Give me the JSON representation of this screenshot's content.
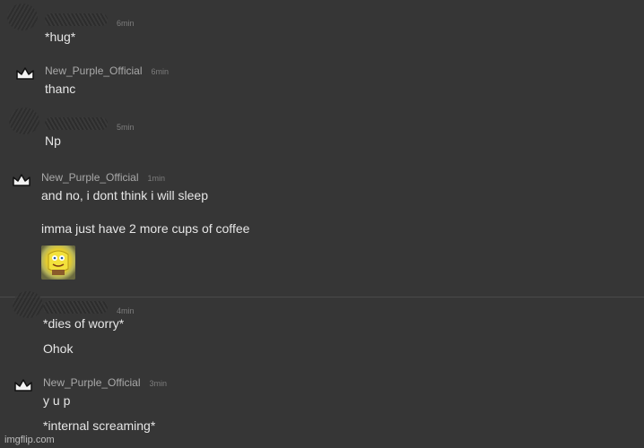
{
  "messages": [
    {
      "username": "",
      "time": "6min",
      "lines": [
        "*hug*"
      ]
    },
    {
      "username": "New_Purple_Official",
      "time": "6min",
      "lines": [
        "thanc"
      ]
    },
    {
      "username": "",
      "time": "5min",
      "lines": [
        "Np"
      ]
    },
    {
      "username": "New_Purple_Official",
      "time": "1min",
      "lines": [
        "and no, i dont think i will sleep",
        "imma just have 2 more cups of coffee"
      ],
      "image": "spongebob-rainbow-meme"
    },
    {
      "username": "",
      "time": "4min",
      "lines": [
        "*dies of worry*",
        "Ohok"
      ]
    },
    {
      "username": "New_Purple_Official",
      "time": "3min",
      "lines": [
        "y u p",
        "*internal screaming*"
      ]
    }
  ],
  "watermark": "imgflip.com",
  "colors": {
    "background": "#363636",
    "text": "#e6e6e6",
    "username": "#a9a9a9",
    "time": "#7d7d7d"
  }
}
